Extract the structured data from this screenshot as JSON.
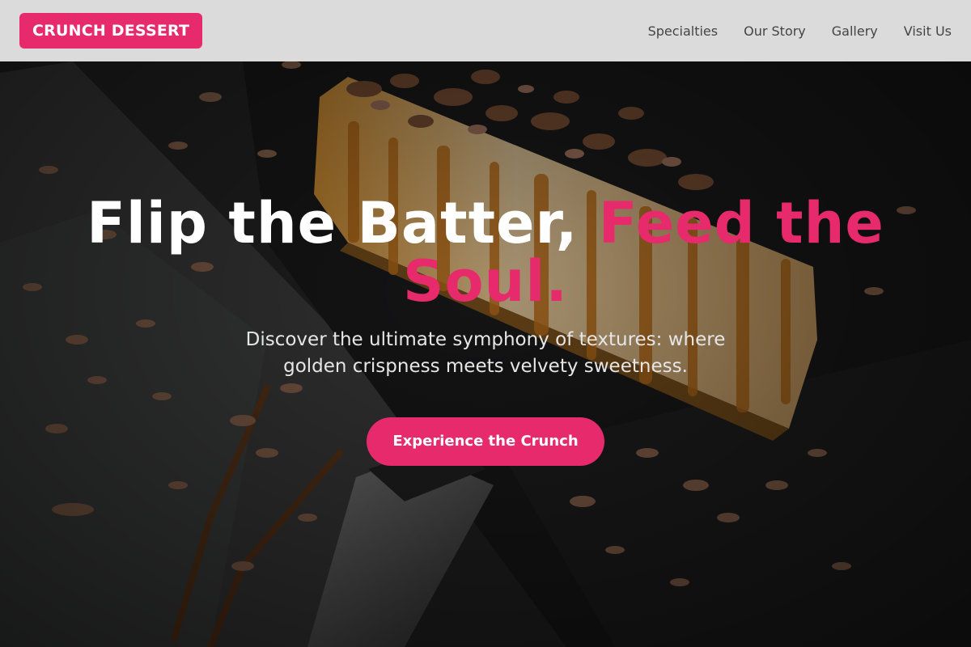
{
  "brand": {
    "logo_text": "CRUNCH DESSERT",
    "accent_color": "#e62a6b"
  },
  "nav": {
    "items": [
      {
        "label": "Specialties"
      },
      {
        "label": "Our Story"
      },
      {
        "label": "Gallery"
      },
      {
        "label": "Visit Us"
      }
    ]
  },
  "hero": {
    "title_main": "Flip the Batter, ",
    "title_accent": "Feed the Soul.",
    "subtitle": "Discover the ultimate symphony of textures: where golden crispness meets velvety sweetness.",
    "cta_label": "Experience the Crunch",
    "background": "photo of a cheesecake slice with caramel drizzle and chocolate shavings on a dark slate with a cake server"
  }
}
